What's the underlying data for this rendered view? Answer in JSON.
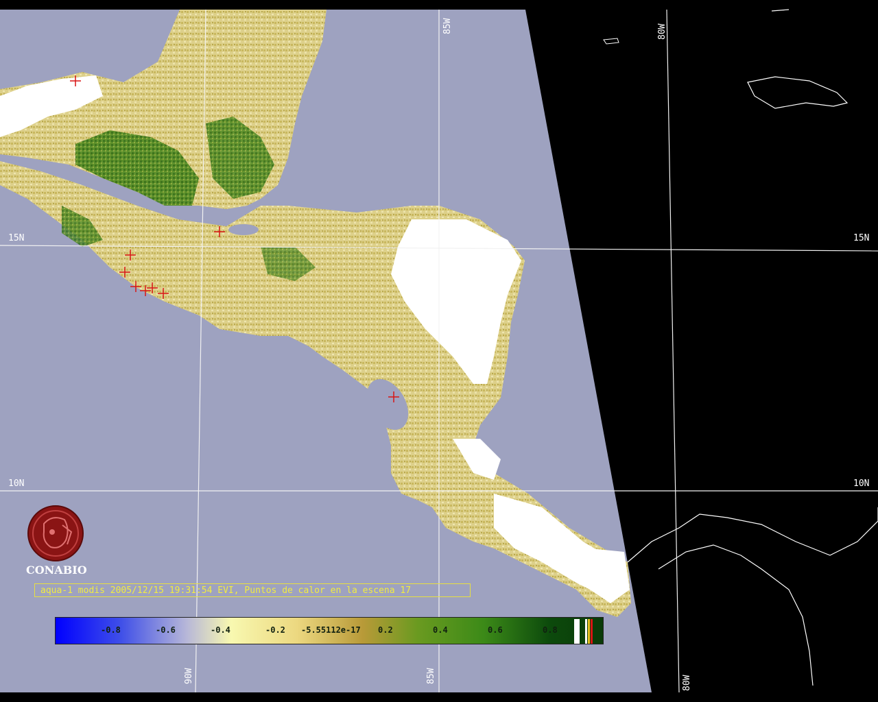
{
  "caption": "aqua-1 modis 2005/12/15 19:31:54 EVI, Puntos de calor en la escena 17",
  "logo_text": "CONABIO",
  "grid_labels": {
    "lon_85w_top": "85W",
    "lon_80w_top": "80W",
    "lon_90w_bottom": "90W",
    "lon_85w_bottom": "85W",
    "lon_80w_bottom": "80W",
    "lat_15n_left": "15N",
    "lat_15n_right": "15N",
    "lat_10n_left": "10N",
    "lat_10n_right": "10N"
  },
  "colorbar": {
    "ticks": [
      "-0.8",
      "-0.6",
      "-0.4",
      "-0.2",
      "-5.55112e-17",
      "0.2",
      "0.4",
      "0.6",
      "0.8"
    ]
  },
  "colors": {
    "ocean": "#9ea2c0",
    "nodata": "#000000",
    "land_low": "#e7dd9a",
    "land_mid": "#c8b860",
    "vegetation": "#2f7a18",
    "cloud": "#ffffff",
    "hotspot": "#d81414"
  }
}
